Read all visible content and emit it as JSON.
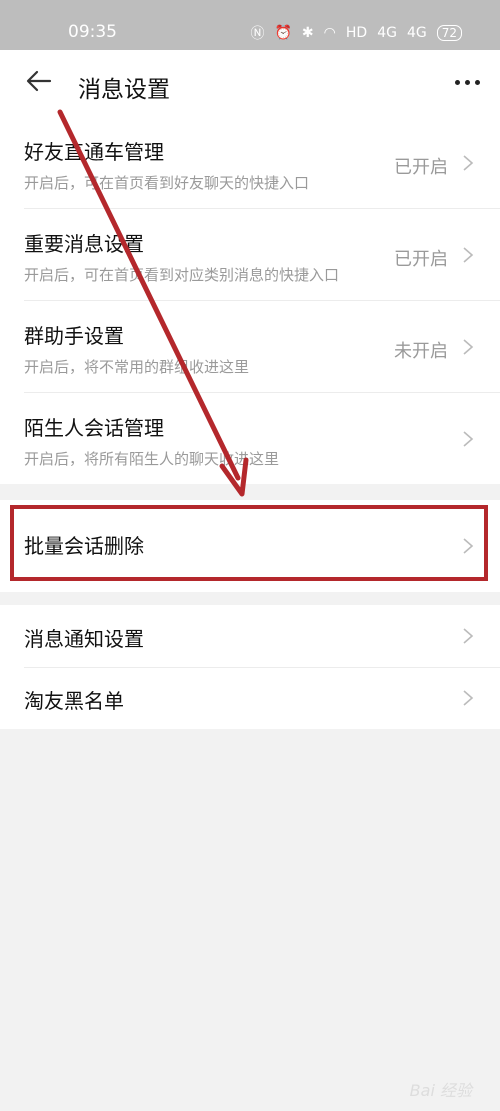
{
  "status_bar": {
    "time": "09:35",
    "signal1": "4G",
    "signal2": "4G",
    "hd": "HD",
    "battery": "72"
  },
  "appbar": {
    "title": "消息设置",
    "back_icon": "back-arrow-icon",
    "more_icon": "more-dots-icon"
  },
  "group1": [
    {
      "label": "好友直通车管理",
      "subtitle": "开启后，可在首页看到好友聊天的快捷入口",
      "status": "已开启"
    },
    {
      "label": "重要消息设置",
      "subtitle": "开启后，可在首页看到对应类别消息的快捷入口",
      "status": "已开启"
    },
    {
      "label": "群助手设置",
      "subtitle": "开启后，将不常用的群组收进这里",
      "status": "未开启"
    },
    {
      "label": "陌生人会话管理",
      "subtitle": "开启后，将所有陌生人的聊天收进这里",
      "status": ""
    }
  ],
  "group2": [
    {
      "label": "批量会话删除"
    }
  ],
  "group3": [
    {
      "label": "消息通知设置"
    },
    {
      "label": "淘友黑名单"
    }
  ],
  "annotation": {
    "highlight_color": "#b4282c"
  },
  "watermark": "Bai 经验"
}
